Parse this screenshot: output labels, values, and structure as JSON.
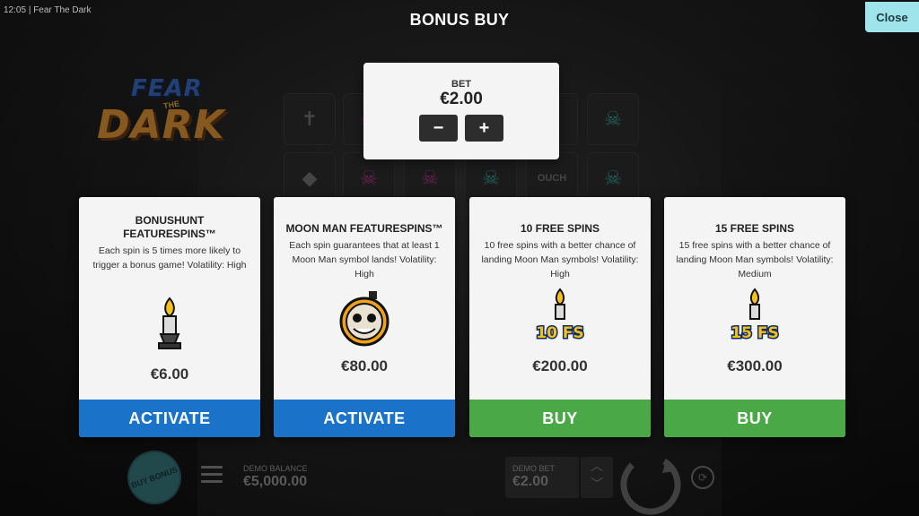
{
  "status": {
    "time": "12:05",
    "separator": "|",
    "game_name": "Fear The Dark"
  },
  "header": {
    "title": "BONUS BUY",
    "close_label": "Close"
  },
  "logo": {
    "word1": "FEAR",
    "word2": "THE",
    "word3": "DARK"
  },
  "bet": {
    "label": "BET",
    "value": "€2.00",
    "decrease_label": "−",
    "increase_label": "+"
  },
  "cards": [
    {
      "title": "BONUSHUNT FEATURESPINS™",
      "description": "Each spin is 5 times more likely to trigger a bonus game! Volatility: High",
      "icon": "candle-icon",
      "price": "€6.00",
      "action_label": "ACTIVATE",
      "action_color": "#1a72c9"
    },
    {
      "title": "MOON MAN FEATURESPINS™",
      "description": "Each spin guarantees that at least 1 Moon Man symbol lands! Volatility: High",
      "icon": "moon-man-icon",
      "price": "€80.00",
      "action_label": "ACTIVATE",
      "action_color": "#1a72c9"
    },
    {
      "title": "10 FREE SPINS",
      "description": "10 free spins with a better chance of landing Moon Man symbols! Volatility: High",
      "icon": "10-fs-candle-icon",
      "icon_text": "10 FS",
      "price": "€200.00",
      "action_label": "BUY",
      "action_color": "#4aa847"
    },
    {
      "title": "15 FREE SPINS",
      "description": "15 free spins with a better chance of landing Moon Man symbols! Volatility: Medium",
      "icon": "15-fs-candle-icon",
      "icon_text": "15 FS",
      "price": "€300.00",
      "action_label": "BUY",
      "action_color": "#4aa847"
    }
  ],
  "bottom_bar": {
    "buy_bonus_label": "BUY BONUS",
    "demo_balance_label": "DEMO BALANCE",
    "demo_balance_value": "€5,000.00",
    "demo_bet_label": "DEMO BET",
    "demo_bet_value": "€2.00"
  },
  "reel_symbols": [
    "✝",
    "☠",
    "☠",
    "☠",
    "☠",
    "☠",
    "◆",
    "☠",
    "☠",
    "☠",
    "OUCH",
    "☠"
  ],
  "colors": {
    "close_bg": "#9ee4ea",
    "blue_button": "#1a72c9",
    "green_button": "#4aa847",
    "card_bg": "#f4f4f4"
  }
}
